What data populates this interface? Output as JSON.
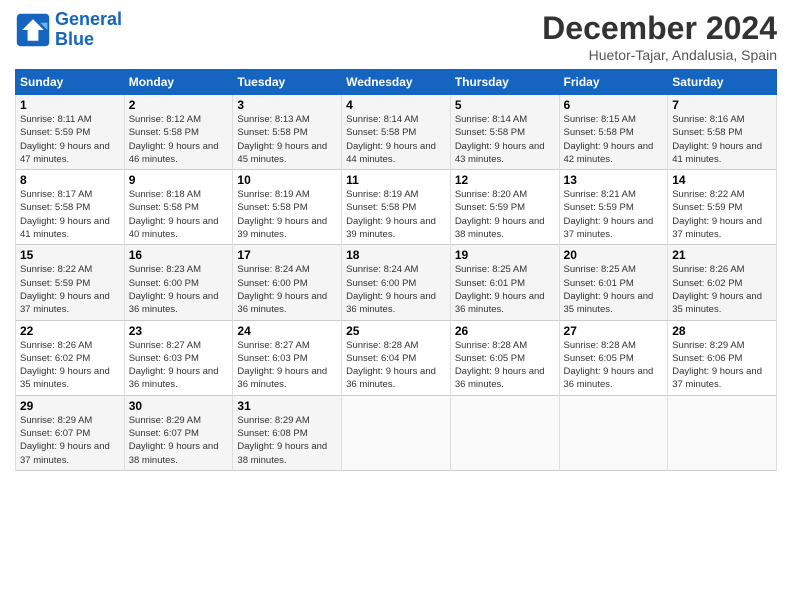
{
  "logo": {
    "line1": "General",
    "line2": "Blue"
  },
  "title": "December 2024",
  "subtitle": "Huetor-Tajar, Andalusia, Spain",
  "header": {
    "colors": {
      "bg": "#1565c0"
    }
  },
  "weekdays": [
    "Sunday",
    "Monday",
    "Tuesday",
    "Wednesday",
    "Thursday",
    "Friday",
    "Saturday"
  ],
  "weeks": [
    [
      {
        "day": "1",
        "sunrise": "8:11 AM",
        "sunset": "5:59 PM",
        "daylight": "9 hours and 47 minutes."
      },
      {
        "day": "2",
        "sunrise": "8:12 AM",
        "sunset": "5:58 PM",
        "daylight": "9 hours and 46 minutes."
      },
      {
        "day": "3",
        "sunrise": "8:13 AM",
        "sunset": "5:58 PM",
        "daylight": "9 hours and 45 minutes."
      },
      {
        "day": "4",
        "sunrise": "8:14 AM",
        "sunset": "5:58 PM",
        "daylight": "9 hours and 44 minutes."
      },
      {
        "day": "5",
        "sunrise": "8:14 AM",
        "sunset": "5:58 PM",
        "daylight": "9 hours and 43 minutes."
      },
      {
        "day": "6",
        "sunrise": "8:15 AM",
        "sunset": "5:58 PM",
        "daylight": "9 hours and 42 minutes."
      },
      {
        "day": "7",
        "sunrise": "8:16 AM",
        "sunset": "5:58 PM",
        "daylight": "9 hours and 41 minutes."
      }
    ],
    [
      {
        "day": "8",
        "sunrise": "8:17 AM",
        "sunset": "5:58 PM",
        "daylight": "9 hours and 41 minutes."
      },
      {
        "day": "9",
        "sunrise": "8:18 AM",
        "sunset": "5:58 PM",
        "daylight": "9 hours and 40 minutes."
      },
      {
        "day": "10",
        "sunrise": "8:19 AM",
        "sunset": "5:58 PM",
        "daylight": "9 hours and 39 minutes."
      },
      {
        "day": "11",
        "sunrise": "8:19 AM",
        "sunset": "5:58 PM",
        "daylight": "9 hours and 39 minutes."
      },
      {
        "day": "12",
        "sunrise": "8:20 AM",
        "sunset": "5:59 PM",
        "daylight": "9 hours and 38 minutes."
      },
      {
        "day": "13",
        "sunrise": "8:21 AM",
        "sunset": "5:59 PM",
        "daylight": "9 hours and 37 minutes."
      },
      {
        "day": "14",
        "sunrise": "8:22 AM",
        "sunset": "5:59 PM",
        "daylight": "9 hours and 37 minutes."
      }
    ],
    [
      {
        "day": "15",
        "sunrise": "8:22 AM",
        "sunset": "5:59 PM",
        "daylight": "9 hours and 37 minutes."
      },
      {
        "day": "16",
        "sunrise": "8:23 AM",
        "sunset": "6:00 PM",
        "daylight": "9 hours and 36 minutes."
      },
      {
        "day": "17",
        "sunrise": "8:24 AM",
        "sunset": "6:00 PM",
        "daylight": "9 hours and 36 minutes."
      },
      {
        "day": "18",
        "sunrise": "8:24 AM",
        "sunset": "6:00 PM",
        "daylight": "9 hours and 36 minutes."
      },
      {
        "day": "19",
        "sunrise": "8:25 AM",
        "sunset": "6:01 PM",
        "daylight": "9 hours and 36 minutes."
      },
      {
        "day": "20",
        "sunrise": "8:25 AM",
        "sunset": "6:01 PM",
        "daylight": "9 hours and 35 minutes."
      },
      {
        "day": "21",
        "sunrise": "8:26 AM",
        "sunset": "6:02 PM",
        "daylight": "9 hours and 35 minutes."
      }
    ],
    [
      {
        "day": "22",
        "sunrise": "8:26 AM",
        "sunset": "6:02 PM",
        "daylight": "9 hours and 35 minutes."
      },
      {
        "day": "23",
        "sunrise": "8:27 AM",
        "sunset": "6:03 PM",
        "daylight": "9 hours and 36 minutes."
      },
      {
        "day": "24",
        "sunrise": "8:27 AM",
        "sunset": "6:03 PM",
        "daylight": "9 hours and 36 minutes."
      },
      {
        "day": "25",
        "sunrise": "8:28 AM",
        "sunset": "6:04 PM",
        "daylight": "9 hours and 36 minutes."
      },
      {
        "day": "26",
        "sunrise": "8:28 AM",
        "sunset": "6:05 PM",
        "daylight": "9 hours and 36 minutes."
      },
      {
        "day": "27",
        "sunrise": "8:28 AM",
        "sunset": "6:05 PM",
        "daylight": "9 hours and 36 minutes."
      },
      {
        "day": "28",
        "sunrise": "8:29 AM",
        "sunset": "6:06 PM",
        "daylight": "9 hours and 37 minutes."
      }
    ],
    [
      {
        "day": "29",
        "sunrise": "8:29 AM",
        "sunset": "6:07 PM",
        "daylight": "9 hours and 37 minutes."
      },
      {
        "day": "30",
        "sunrise": "8:29 AM",
        "sunset": "6:07 PM",
        "daylight": "9 hours and 38 minutes."
      },
      {
        "day": "31",
        "sunrise": "8:29 AM",
        "sunset": "6:08 PM",
        "daylight": "9 hours and 38 minutes."
      },
      null,
      null,
      null,
      null
    ]
  ]
}
